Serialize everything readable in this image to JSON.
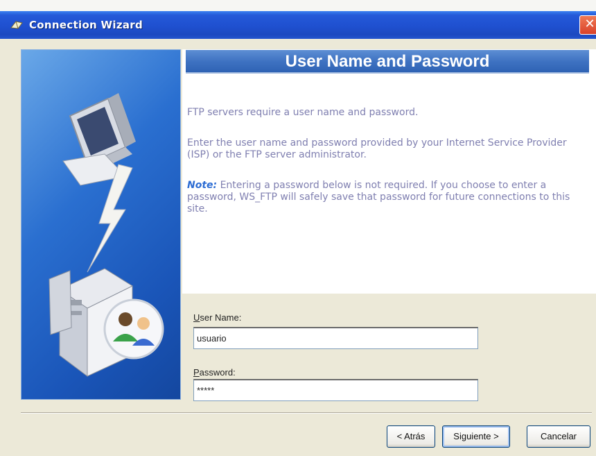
{
  "window": {
    "title": "Connection Wizard",
    "close_glyph": "✕"
  },
  "header": {
    "title": "User Name and Password"
  },
  "body": {
    "line1": "FTP servers require a user name and password.",
    "line2": "Enter the user name and password provided by your Internet Service Provider (ISP) or the FTP server administrator.",
    "note_label": "Note:",
    "note_text": " Entering a password below is not required. If you choose to enter a password, WS_FTP will safely save that password for future connections to this site."
  },
  "form": {
    "username_label_accel": "U",
    "username_label_rest": "ser Name:",
    "username_value": "usuario",
    "password_label_accel": "P",
    "password_label_rest": "assword:",
    "password_value": "*****"
  },
  "buttons": {
    "back": "< Atrás",
    "next": "Siguiente >",
    "cancel": "Cancelar"
  },
  "icons": [
    "wizard-app-icon",
    "close-icon",
    "monitor-icon",
    "lightning-bolt-icon",
    "server-tower-icon",
    "users-icon"
  ],
  "colors": {
    "title_bar": "#1f50d0",
    "header_bar": "#3f73c2",
    "panel": "#2a6fd0",
    "note": "#2c6cd3",
    "body_text": "#7f7fb0"
  }
}
